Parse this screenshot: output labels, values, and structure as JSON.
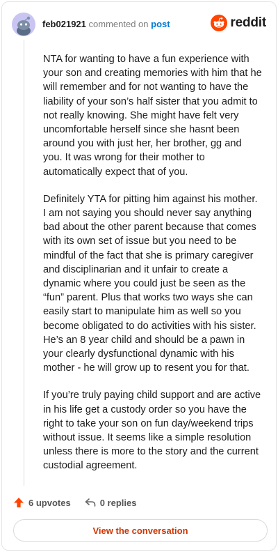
{
  "header": {
    "username": "feb021921",
    "commented_on": "commented on",
    "post_link": "post",
    "brand": "reddit"
  },
  "comment": {
    "paragraphs": [
      "NTA for wanting to have a fun experience with your son and creating memories with him that he will remember and for not wanting to have the liability of your son’s half sister that you admit to not really knowing. She might have felt very uncomfortable herself since she hasnt been around you with just her, her brother, gg and you. It was wrong for their mother to automatically expect that of you.",
      "Definitely YTA for pitting him against his mother. I am not saying you should never say anything bad about the other parent because that comes with its own set of issue but you need to be mindful of the fact that she is primary caregiver and disciplinarian and it unfair to create a dynamic where you could just be seen as the “fun” parent. Plus that works two ways she can easily start to manipulate him as well so you become obligated to do activities with his sister. He’s an 8 year child and should be a pawn in your clearly dysfunctional dynamic with his mother - he will grow up to resent you for that.",
      "If you’re truly paying child support and are active in his life get a custody order so you have the right to take your son on fun day/weekend trips without issue. It seems like a simple resolution unless there is more to the story and the current custodial agreement."
    ]
  },
  "actions": {
    "upvotes": "6 upvotes",
    "replies": "0 replies"
  },
  "cta": {
    "label": "View the conversation"
  },
  "colors": {
    "brand_orange": "#ff4500",
    "link_blue": "#0079d3",
    "cta_text": "#cc3700"
  },
  "icons": [
    "avatar-icon",
    "reddit-logo-icon",
    "upvote-arrow-icon",
    "reply-arrow-icon"
  ]
}
